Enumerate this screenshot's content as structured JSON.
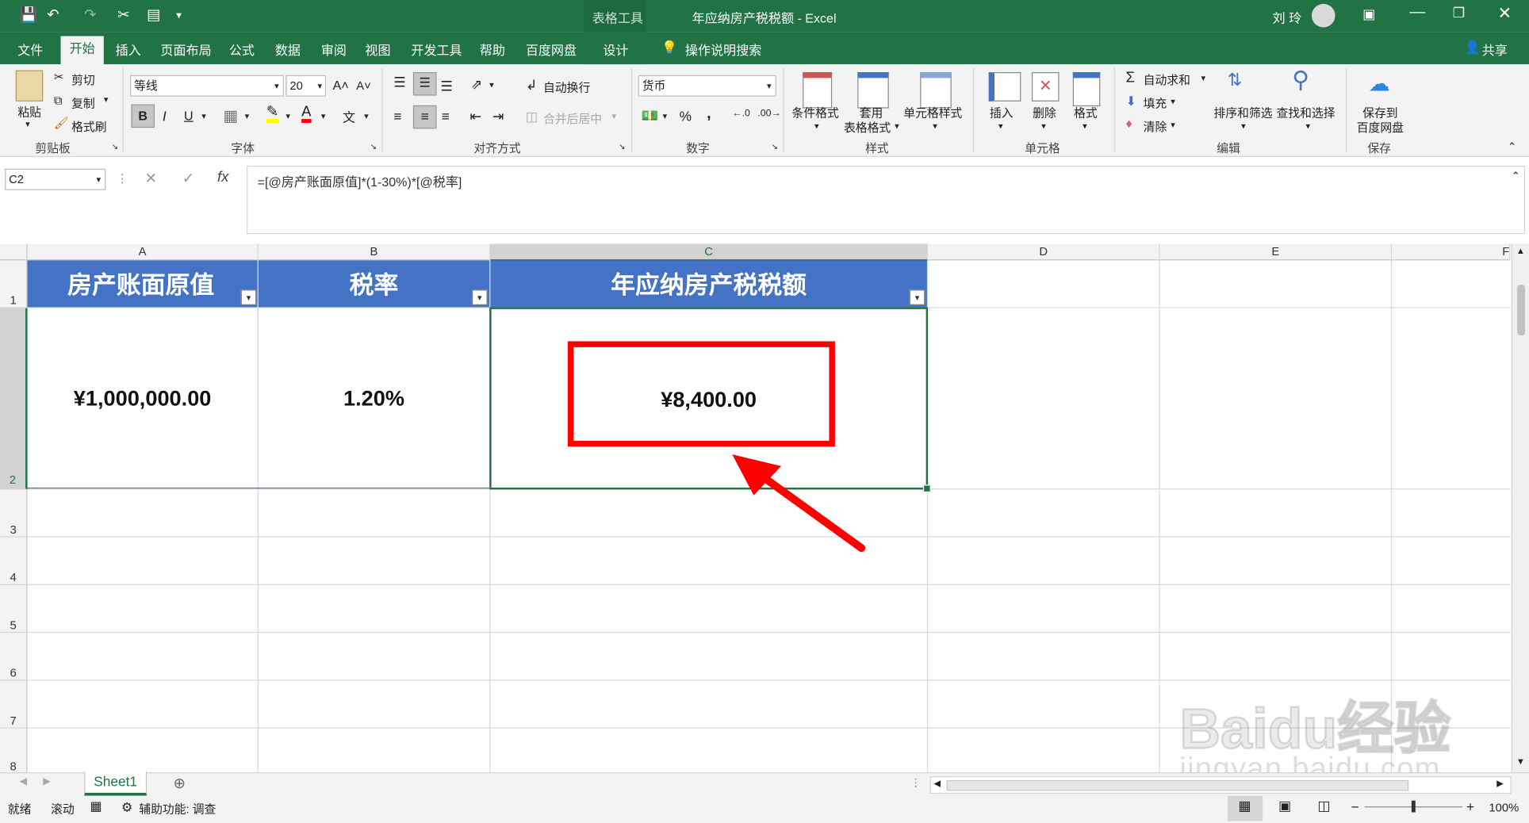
{
  "window": {
    "title": "年应纳房产税税额 - Excel",
    "tools_label": "表格工具",
    "user": "刘 玲"
  },
  "tabs": [
    "文件",
    "开始",
    "插入",
    "页面布局",
    "公式",
    "数据",
    "审阅",
    "视图",
    "开发工具",
    "帮助",
    "百度网盘",
    "设计"
  ],
  "tell_me": "操作说明搜索",
  "share": "共享",
  "ribbon": {
    "clipboard": {
      "paste": "粘贴",
      "cut": "剪切",
      "copy": "复制",
      "format_painter": "格式刷",
      "group": "剪贴板"
    },
    "font": {
      "name": "等线",
      "size": "20",
      "bold": "B",
      "italic": "I",
      "underline": "U",
      "group": "字体"
    },
    "alignment": {
      "wrap": "自动换行",
      "merge": "合并后居中",
      "group": "对齐方式"
    },
    "number": {
      "format": "货币",
      "percent": "%",
      "comma": ",",
      "group": "数字"
    },
    "styles": {
      "conditional": "条件格式",
      "table_format_1": "套用",
      "table_format_2": "表格格式",
      "cell_styles": "单元格样式",
      "group": "样式"
    },
    "cells": {
      "insert": "插入",
      "delete": "删除",
      "format": "格式",
      "group": "单元格"
    },
    "editing": {
      "autosum": "自动求和",
      "fill": "填充",
      "clear": "清除",
      "sort": "排序和筛选",
      "find": "查找和选择",
      "group": "编辑"
    },
    "save": {
      "label_1": "保存到",
      "label_2": "百度网盘",
      "group": "保存"
    }
  },
  "formula_bar": {
    "name_box": "C2",
    "formula": "=[@房产账面原值]*(1-30%)*[@税率]"
  },
  "columns": [
    "A",
    "B",
    "C",
    "D",
    "E",
    "F"
  ],
  "rows": [
    "1",
    "2",
    "3",
    "4",
    "5",
    "6",
    "7",
    "8"
  ],
  "table": {
    "headers": [
      "房产账面原值",
      "税率",
      "年应纳房产税税额"
    ],
    "values": [
      "¥1,000,000.00",
      "1.20%",
      "¥8,400.00"
    ]
  },
  "sheet_tab": "Sheet1",
  "status": {
    "ready": "就绪",
    "scroll": "滚动",
    "accessibility": "辅助功能: 调查",
    "zoom": "100%"
  },
  "watermark": {
    "brand": "Baidu经验",
    "url": "jingyan.baidu.com"
  },
  "colors": {
    "excel_green": "#217346",
    "table_header": "#4472c4",
    "highlight": "#ff0000"
  }
}
